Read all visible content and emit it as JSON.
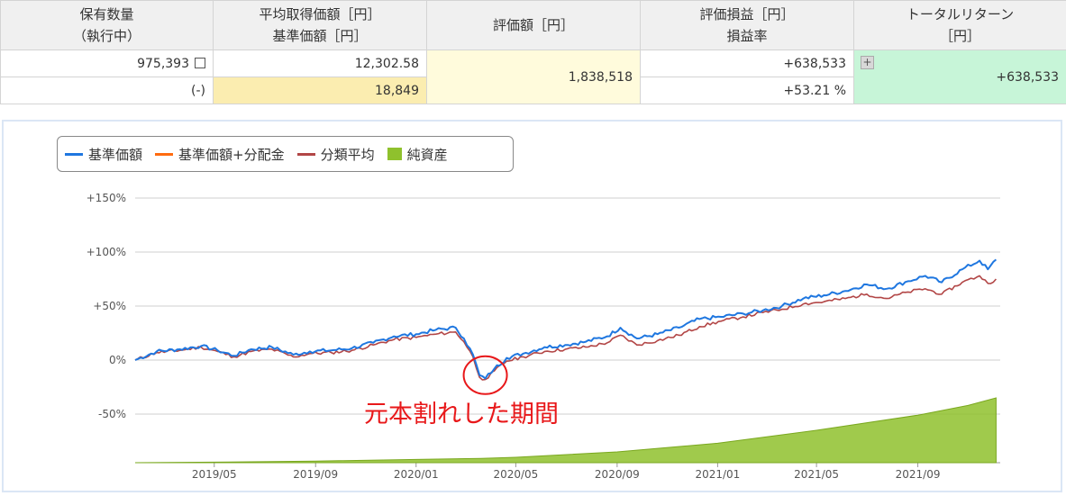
{
  "table": {
    "headers": {
      "qty_l1": "保有数量",
      "qty_l2": "（執行中）",
      "avg_l1": "平均取得価額［円］",
      "avg_l2": "基準価額［円］",
      "value": "評価額［円］",
      "pl_l1": "評価損益［円］",
      "pl_l2": "損益率",
      "tr_l1": "トータルリターン",
      "tr_l2": "［円］"
    },
    "qty": "975,393",
    "pending": "(-)",
    "avg_cost": "12,302.58",
    "nav": "18,849",
    "value": "1,838,518",
    "pl": "+638,533",
    "pl_rate": "+53.21 %",
    "total_return": "+638,533",
    "plus_symbol": "+",
    "colors": {
      "positive": "#d40000",
      "value_bg": "#fffbdc",
      "nav_bg": "#fbedb0",
      "return_bg": "#c7f5d8"
    }
  },
  "legend": [
    {
      "label": "基準価額",
      "color": "#1f77e0"
    },
    {
      "label": "基準価額+分配金",
      "color": "#ff6b0f"
    },
    {
      "label": "分類平均",
      "color": "#b24646"
    },
    {
      "label": "純資産",
      "color": "#8fc12d"
    }
  ],
  "annotation": "元本割れした期間",
  "chart_data": {
    "type": "line",
    "y_tick_labels": [
      "+150%",
      "+100%",
      "+50%",
      "0%",
      "-50%"
    ],
    "y_ticks": [
      150,
      100,
      50,
      0,
      -50
    ],
    "ylim": [
      -95,
      160
    ],
    "x_tick_labels": [
      "2019/05",
      "2019/09",
      "2020/01",
      "2020/05",
      "2020/09",
      "2021/01",
      "2021/05",
      "2021/09"
    ],
    "x_ticks": [
      "2019-05-01",
      "2019-09-01",
      "2020-01-01",
      "2020-05-01",
      "2020-09-01",
      "2021-01-01",
      "2021-05-01",
      "2021-09-01"
    ],
    "x_range": [
      "2019-01-25",
      "2021-12-10"
    ],
    "series": [
      {
        "name": "基準価額",
        "color": "#1f77e0",
        "x": [
          "2019-01-25",
          "2019-02-20",
          "2019-03-20",
          "2019-04-15",
          "2019-05-05",
          "2019-05-25",
          "2019-06-15",
          "2019-07-10",
          "2019-08-05",
          "2019-08-25",
          "2019-09-20",
          "2019-10-15",
          "2019-11-10",
          "2019-12-05",
          "2020-01-01",
          "2020-01-25",
          "2020-02-18",
          "2020-02-28",
          "2020-03-10",
          "2020-03-18",
          "2020-03-25",
          "2020-04-05",
          "2020-04-20",
          "2020-05-10",
          "2020-06-05",
          "2020-06-30",
          "2020-07-25",
          "2020-08-20",
          "2020-09-05",
          "2020-09-25",
          "2020-10-20",
          "2020-11-15",
          "2020-12-10",
          "2021-01-05",
          "2021-02-01",
          "2021-02-25",
          "2021-03-20",
          "2021-04-15",
          "2021-05-10",
          "2021-06-05",
          "2021-07-01",
          "2021-07-25",
          "2021-08-20",
          "2021-09-10",
          "2021-09-30",
          "2021-10-25",
          "2021-11-15",
          "2021-11-25",
          "2021-12-05"
        ],
        "y": [
          0,
          8,
          10,
          13,
          9,
          4,
          10,
          12,
          5,
          8,
          9,
          11,
          16,
          22,
          24,
          28,
          30,
          20,
          5,
          -14,
          -17,
          -8,
          2,
          6,
          12,
          14,
          17,
          22,
          30,
          20,
          24,
          30,
          38,
          40,
          43,
          46,
          50,
          57,
          60,
          64,
          70,
          66,
          73,
          78,
          72,
          84,
          92,
          84,
          93
        ]
      },
      {
        "name": "分類平均",
        "color": "#b24646",
        "x": [
          "2019-01-25",
          "2019-02-20",
          "2019-03-20",
          "2019-04-15",
          "2019-05-05",
          "2019-05-25",
          "2019-06-15",
          "2019-07-10",
          "2019-08-05",
          "2019-08-25",
          "2019-09-20",
          "2019-10-15",
          "2019-11-10",
          "2019-12-05",
          "2020-01-01",
          "2020-01-25",
          "2020-02-18",
          "2020-02-28",
          "2020-03-10",
          "2020-03-18",
          "2020-03-25",
          "2020-04-05",
          "2020-04-20",
          "2020-05-10",
          "2020-06-05",
          "2020-06-30",
          "2020-07-25",
          "2020-08-20",
          "2020-09-05",
          "2020-09-25",
          "2020-10-20",
          "2020-11-15",
          "2020-12-10",
          "2021-01-05",
          "2021-02-01",
          "2021-02-25",
          "2021-03-20",
          "2021-04-15",
          "2021-05-10",
          "2021-06-05",
          "2021-07-01",
          "2021-07-25",
          "2021-08-20",
          "2021-09-10",
          "2021-09-30",
          "2021-10-25",
          "2021-11-15",
          "2021-11-25",
          "2021-12-05"
        ],
        "y": [
          0,
          7,
          9,
          12,
          8,
          3,
          8,
          10,
          3,
          6,
          7,
          9,
          14,
          19,
          21,
          24,
          26,
          17,
          3,
          -16,
          -18,
          -10,
          -1,
          3,
          8,
          10,
          12,
          16,
          23,
          14,
          18,
          23,
          31,
          36,
          40,
          44,
          47,
          52,
          54,
          57,
          61,
          57,
          63,
          66,
          61,
          72,
          78,
          71,
          75
        ]
      },
      {
        "name": "純資産",
        "color": "#8fc12d",
        "x": [
          "2019-01-25",
          "2019-05-01",
          "2019-09-01",
          "2020-01-01",
          "2020-03-20",
          "2020-05-01",
          "2020-09-01",
          "2021-01-01",
          "2021-05-01",
          "2021-09-01",
          "2021-11-01",
          "2021-12-05"
        ],
        "y": [
          -95,
          -94.5,
          -93.5,
          -92,
          -91,
          -90,
          -85,
          -77,
          -65,
          -51,
          -42,
          -35
        ]
      }
    ]
  }
}
